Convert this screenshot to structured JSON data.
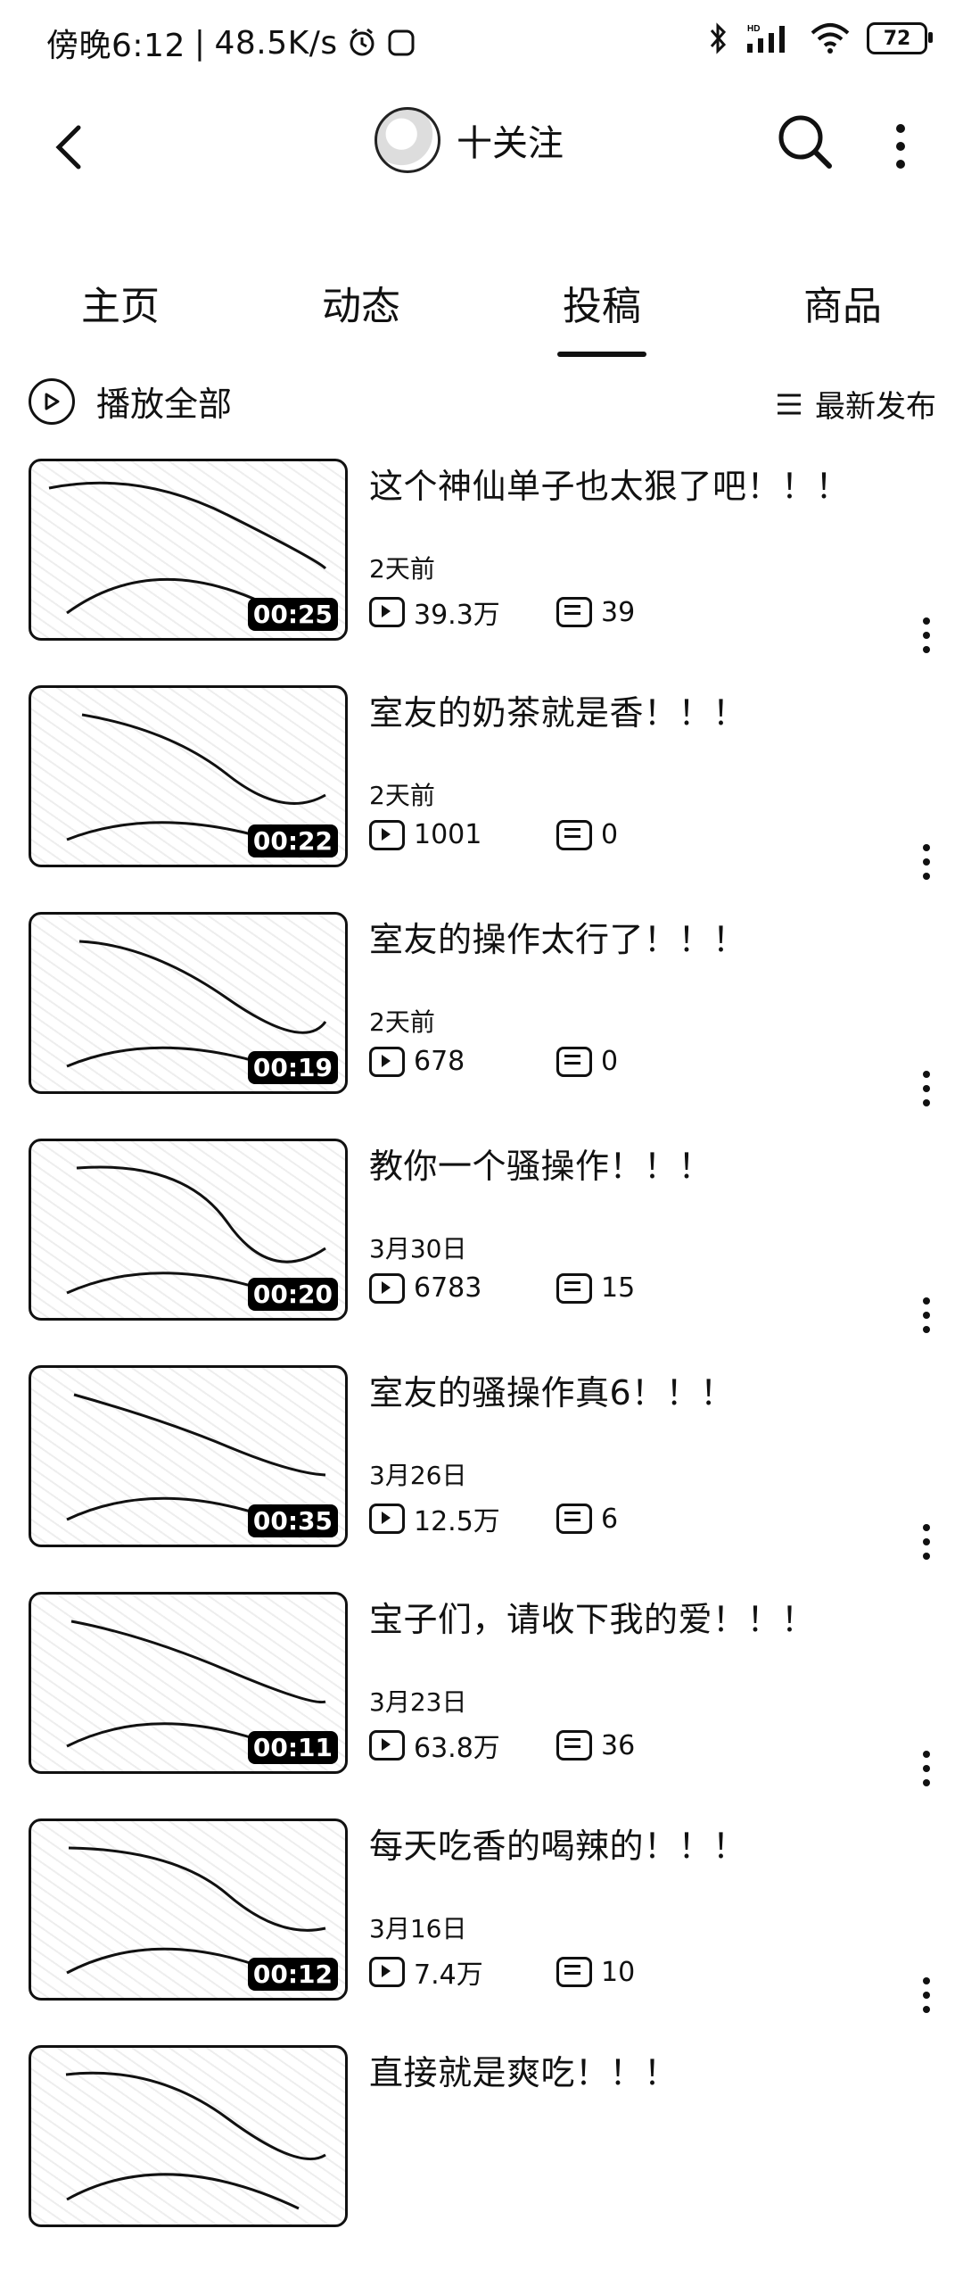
{
  "status": {
    "time": "傍晚6:12",
    "speed": "48.5K/s",
    "battery": "72"
  },
  "topnav": {
    "follow_label": "十关注"
  },
  "tabs": [
    {
      "label": "主页",
      "active": false
    },
    {
      "label": "动态",
      "active": false
    },
    {
      "label": "投稿",
      "active": true
    },
    {
      "label": "商品",
      "active": false
    }
  ],
  "toolbar": {
    "play_all": "播放全部",
    "sort": "最新发布"
  },
  "videos": [
    {
      "title": "这个神仙单子也太狠了吧！！！",
      "date": "2天前",
      "views": "39.3万",
      "comments": "39",
      "duration": "00:25"
    },
    {
      "title": "室友的奶茶就是香！！！",
      "date": "2天前",
      "views": "1001",
      "comments": "0",
      "duration": "00:22"
    },
    {
      "title": "室友的操作太行了！！！",
      "date": "2天前",
      "views": "678",
      "comments": "0",
      "duration": "00:19"
    },
    {
      "title": "教你一个骚操作！！！",
      "date": "3月30日",
      "views": "6783",
      "comments": "15",
      "duration": "00:20"
    },
    {
      "title": "室友的骚操作真6！！！",
      "date": "3月26日",
      "views": "12.5万",
      "comments": "6",
      "duration": "00:35"
    },
    {
      "title": "宝子们，请收下我的爱！！！",
      "date": "3月23日",
      "views": "63.8万",
      "comments": "36",
      "duration": "00:11"
    },
    {
      "title": "每天吃香的喝辣的！！！",
      "date": "3月16日",
      "views": "7.4万",
      "comments": "10",
      "duration": "00:12"
    },
    {
      "title": "直接就是爽吃！！！",
      "date": "",
      "views": "",
      "comments": "",
      "duration": ""
    }
  ]
}
